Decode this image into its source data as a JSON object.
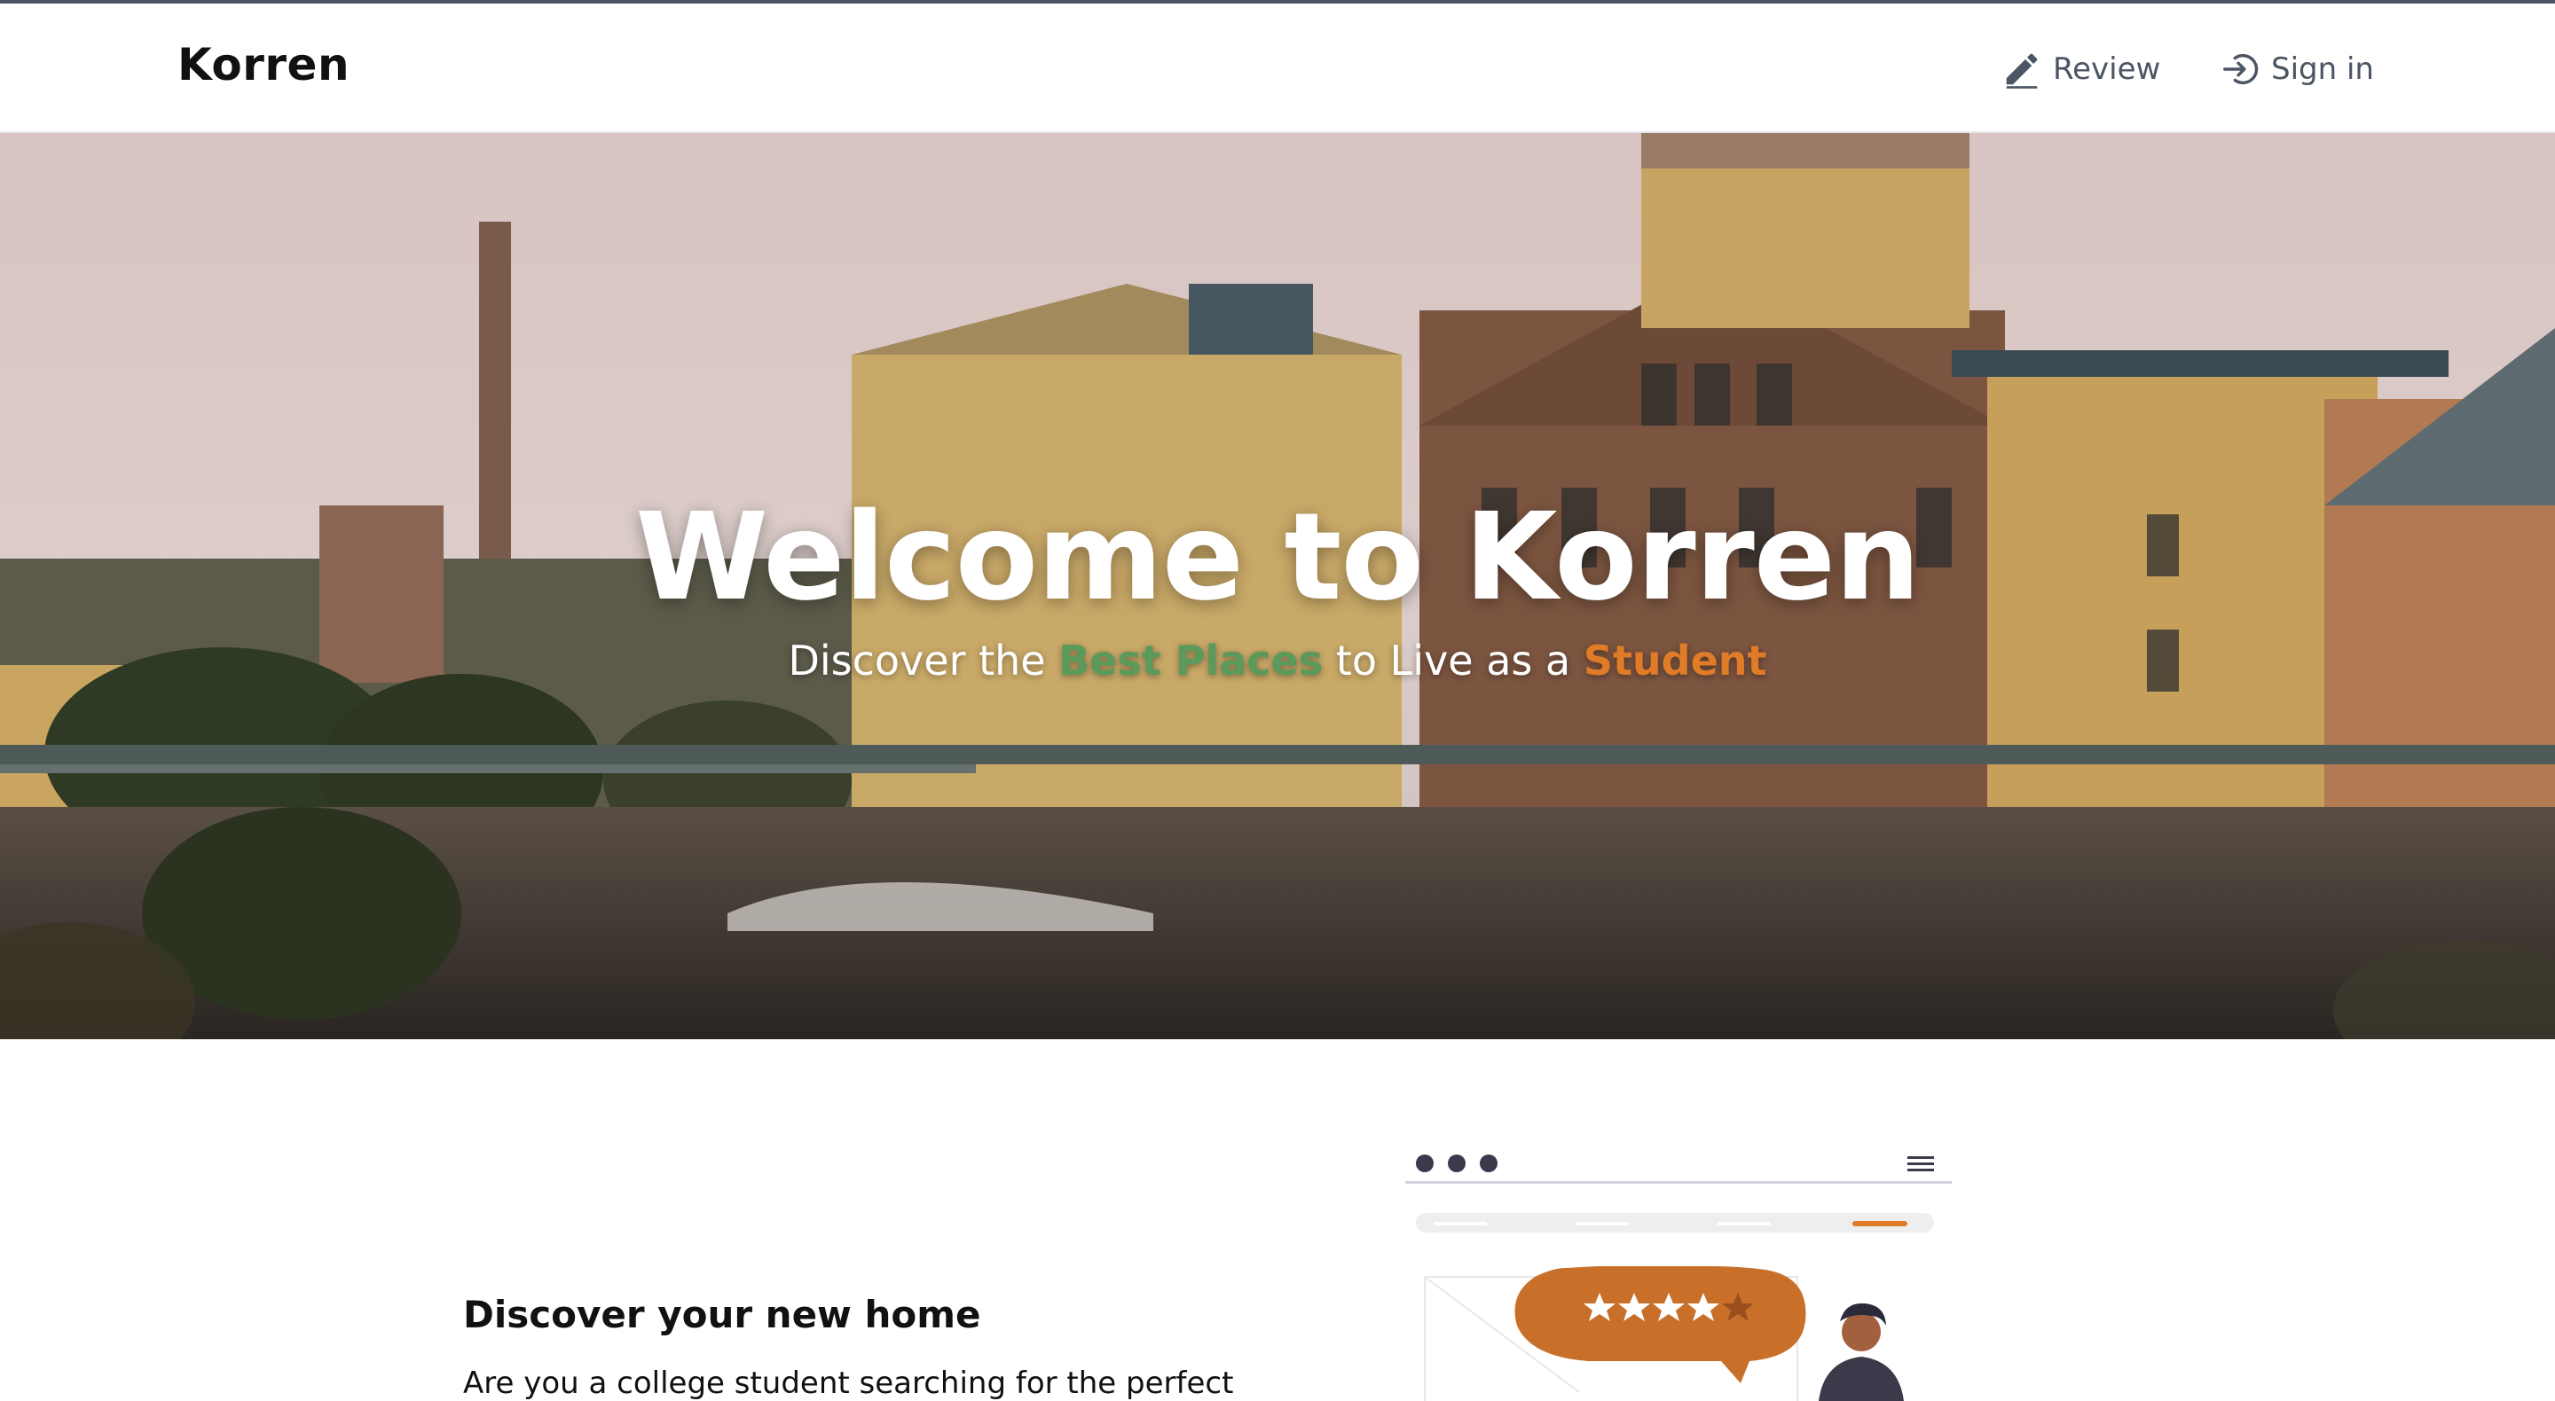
{
  "header": {
    "brand": "Korren",
    "nav": {
      "review_label": "Review",
      "signin_label": "Sign in"
    }
  },
  "hero": {
    "title": "Welcome to Korren",
    "subtitle": {
      "part1": "Discover the ",
      "highlight_green": "Best Places",
      "part2": " to Live as a ",
      "highlight_orange": "Student"
    }
  },
  "section": {
    "title": "Discover your new home",
    "text": "Are you a college student searching for the perfect"
  },
  "colors": {
    "accent_orange": "#e07b27",
    "accent_green": "#5a9a5a",
    "text_dark": "#111111",
    "nav_gray": "#4b5563"
  },
  "icons": {
    "review": "pencil-icon",
    "signin": "sign-in-icon"
  }
}
